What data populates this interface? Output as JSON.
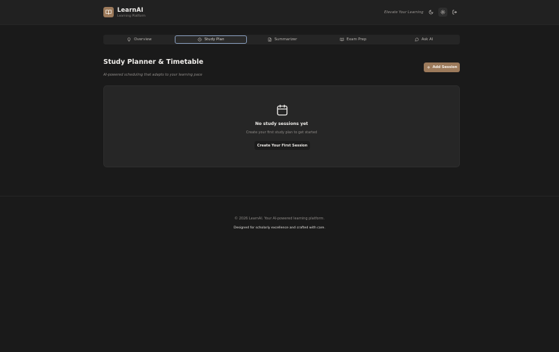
{
  "header": {
    "brand_title": "LearnAI",
    "brand_subtitle": "Learning Platform",
    "tagline": "Elevate Your Learning",
    "icons": [
      "book-open-icon",
      "moon-icon",
      "gear-icon",
      "logout-icon"
    ]
  },
  "tabs": [
    {
      "label": "Overview",
      "icon": "lightbulb-icon",
      "active": false
    },
    {
      "label": "Study Plan",
      "icon": "clock-icon",
      "active": true
    },
    {
      "label": "Summarizer",
      "icon": "document-icon",
      "active": false
    },
    {
      "label": "Exam Prep",
      "icon": "book-open-icon",
      "active": false
    },
    {
      "label": "Ask AI",
      "icon": "chat-bubble-icon",
      "active": false
    }
  ],
  "main": {
    "title": "Study Planner & Timetable",
    "subtitle": "AI-powered scheduling that adapts to your learning pace",
    "add_button": "Add Session",
    "empty_state": {
      "icon": "calendar-icon",
      "title": "No study sessions yet",
      "subtitle": "Create your first study plan to get started",
      "button": "Create Your First Session"
    }
  },
  "footer": {
    "copyright": "© 2026 LearnAI. Your AI-powered learning platform.",
    "tagline": "Designed for scholarly excellence and crafted with care."
  },
  "colors": {
    "background": "#1a1a1a",
    "header": "#212121",
    "card": "#262626",
    "accent": "#9c7a5b",
    "active_tab_border": "#8aa0c0"
  }
}
